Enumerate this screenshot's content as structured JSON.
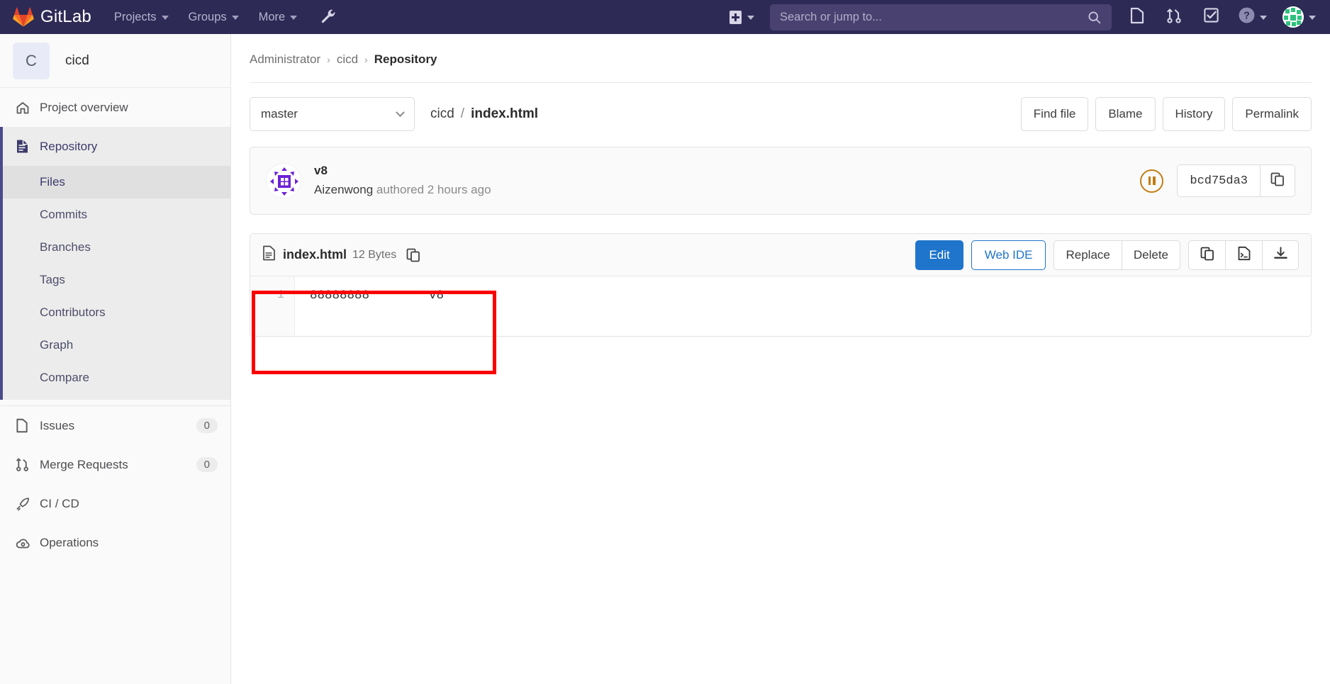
{
  "topnav": {
    "brand": "GitLab",
    "brand_icon": "gitlab-logo-icon",
    "items": [
      {
        "label": "Projects",
        "icon": "chevron-down-icon"
      },
      {
        "label": "Groups",
        "icon": "chevron-down-icon"
      },
      {
        "label": "More",
        "icon": "chevron-down-icon"
      }
    ],
    "wrench_icon": "wrench-icon",
    "new_icon": "plus-square-icon",
    "new_caret_icon": "chevron-down-icon",
    "search": {
      "value": "",
      "placeholder": "Search or jump to...",
      "icon": "search-icon"
    },
    "right_icons": [
      "issues-icon",
      "merge-requests-icon",
      "todos-checkbox-icon"
    ],
    "help_icon": "question-circle-icon",
    "help_caret_icon": "chevron-down-icon",
    "avatar_icon": "user-avatar",
    "user_caret_icon": "chevron-down-icon"
  },
  "sidebar": {
    "project": {
      "initial": "C",
      "name": "cicd"
    },
    "items": [
      {
        "label": "Project overview",
        "icon": "home-icon",
        "active": false,
        "count": null
      },
      {
        "label": "Repository",
        "icon": "document-icon",
        "active": true,
        "count": null
      }
    ],
    "repository_sub": [
      {
        "label": "Files",
        "active": true
      },
      {
        "label": "Commits",
        "active": false
      },
      {
        "label": "Branches",
        "active": false
      },
      {
        "label": "Tags",
        "active": false
      },
      {
        "label": "Contributors",
        "active": false
      },
      {
        "label": "Graph",
        "active": false
      },
      {
        "label": "Compare",
        "active": false
      }
    ],
    "items_bottom": [
      {
        "label": "Issues",
        "icon": "issues-icon",
        "count": "0"
      },
      {
        "label": "Merge Requests",
        "icon": "merge-requests-icon",
        "count": "0"
      },
      {
        "label": "CI / CD",
        "icon": "rocket-icon",
        "count": null
      },
      {
        "label": "Operations",
        "icon": "cloud-gear-icon",
        "count": null
      }
    ]
  },
  "breadcrumb": {
    "items": [
      "Administrator",
      "cicd"
    ],
    "current": "Repository",
    "separator": "›"
  },
  "tree_bar": {
    "branch": {
      "value": "master",
      "caret_icon": "chevron-down-icon"
    },
    "path": {
      "root": "cicd",
      "separator": "/",
      "file": "index.html"
    },
    "buttons": [
      "Find file",
      "Blame",
      "History",
      "Permalink"
    ]
  },
  "commit": {
    "avatar_icon": "identicon-avatar",
    "title": "v8",
    "author": "Aizenwong",
    "meta_suffix": "authored 2 hours ago",
    "pipeline_status_icon": "pipeline-manual-icon",
    "sha": "bcd75da3",
    "copy_icon": "clipboard-icon"
  },
  "file": {
    "icon": "file-doc-icon",
    "name": "index.html",
    "size": "12 Bytes",
    "copy_path_icon": "clipboard-icon",
    "actions": {
      "edit": "Edit",
      "web_ide": "Web IDE",
      "replace": "Replace",
      "delete": "Delete",
      "icon_buttons": [
        "clipboard-icon",
        "open-raw-icon",
        "download-icon"
      ]
    },
    "lines": [
      {
        "number": "1",
        "text": "88888888        v8"
      }
    ]
  },
  "annotation": {
    "shape": "rectangle",
    "color": "#fb0000"
  },
  "colors": {
    "nav_bg": "#2e2a56",
    "search_bg": "#494270",
    "sidebar_bg": "#fafafa",
    "accent_blue": "#1f75cb",
    "pipeline_orange": "#c17d11",
    "annotation_red": "#fb0000"
  }
}
